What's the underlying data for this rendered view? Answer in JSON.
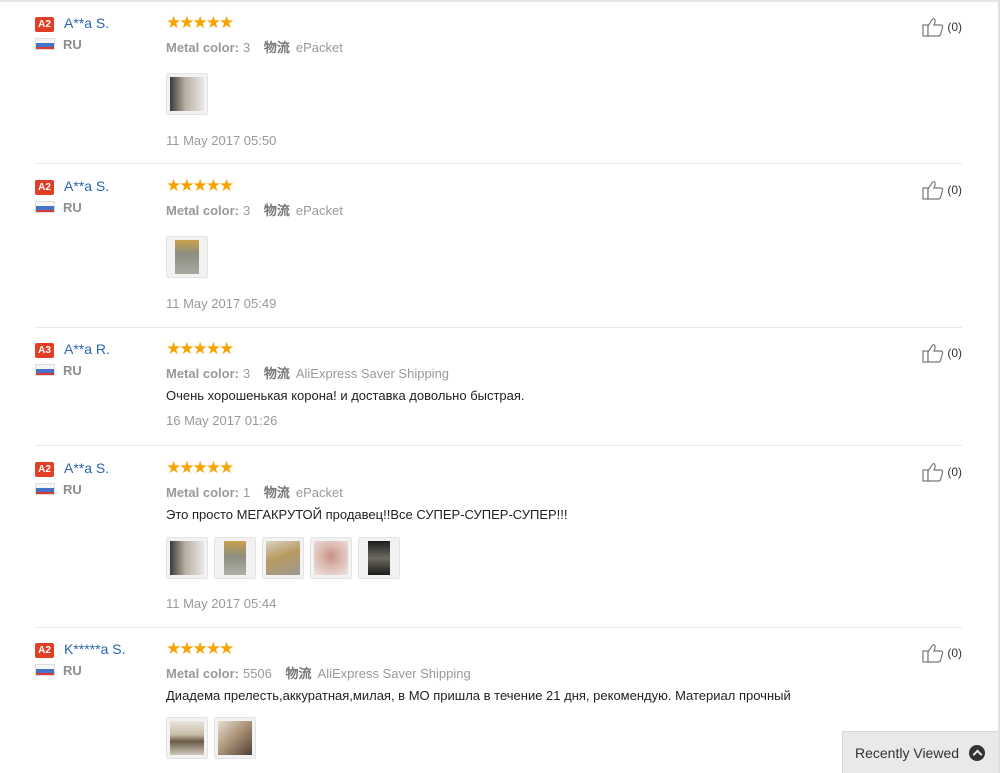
{
  "reviews": [
    {
      "level": "A2",
      "name": "A**a S.",
      "country": "RU",
      "stars": "★★★★★",
      "attr_label": "Metal color:",
      "attr_value": "3",
      "shipping_label": "物流",
      "shipping_value": "ePacket",
      "text": "",
      "photos": 1,
      "date": "11 May 2017 05:50",
      "helpful": "(0)"
    },
    {
      "level": "A2",
      "name": "A**a S.",
      "country": "RU",
      "stars": "★★★★★",
      "attr_label": "Metal color:",
      "attr_value": "3",
      "shipping_label": "物流",
      "shipping_value": "ePacket",
      "text": "",
      "photos": 1,
      "date": "11 May 2017 05:49",
      "helpful": "(0)"
    },
    {
      "level": "A3",
      "name": "A**a R.",
      "country": "RU",
      "stars": "★★★★★",
      "attr_label": "Metal color:",
      "attr_value": "3",
      "shipping_label": "物流",
      "shipping_value": "AliExpress Saver Shipping",
      "text": "Очень хорошенькая корона! и доставка довольно быстрая.",
      "photos": 0,
      "date": "16 May 2017 01:26",
      "helpful": "(0)"
    },
    {
      "level": "A2",
      "name": "A**a S.",
      "country": "RU",
      "stars": "★★★★★",
      "attr_label": "Metal color:",
      "attr_value": "1",
      "shipping_label": "物流",
      "shipping_value": "ePacket",
      "text": "Это просто МЕГАКРУТОЙ продавец!!Все СУПЕР-СУПЕР-СУПЕР!!!",
      "photos": 5,
      "date": "11 May 2017 05:44",
      "helpful": "(0)"
    },
    {
      "level": "A2",
      "name": "K*****a S.",
      "country": "RU",
      "stars": "★★★★★",
      "attr_label": "Metal color:",
      "attr_value": "5506",
      "shipping_label": "物流",
      "shipping_value": "AliExpress Saver Shipping",
      "text": "Диадема прелесть,аккуратная,милая, в МО пришла в течение 21 дня, рекомендую. Материал прочный",
      "photos": 2,
      "date": "",
      "helpful": "(0)"
    }
  ],
  "recently_viewed": {
    "label": "Recently Viewed",
    "icon": "chevron-up-circle-icon"
  },
  "colors": {
    "badge": "#e23d25",
    "star": "#f7a300",
    "name_link": "#2a64b0"
  }
}
